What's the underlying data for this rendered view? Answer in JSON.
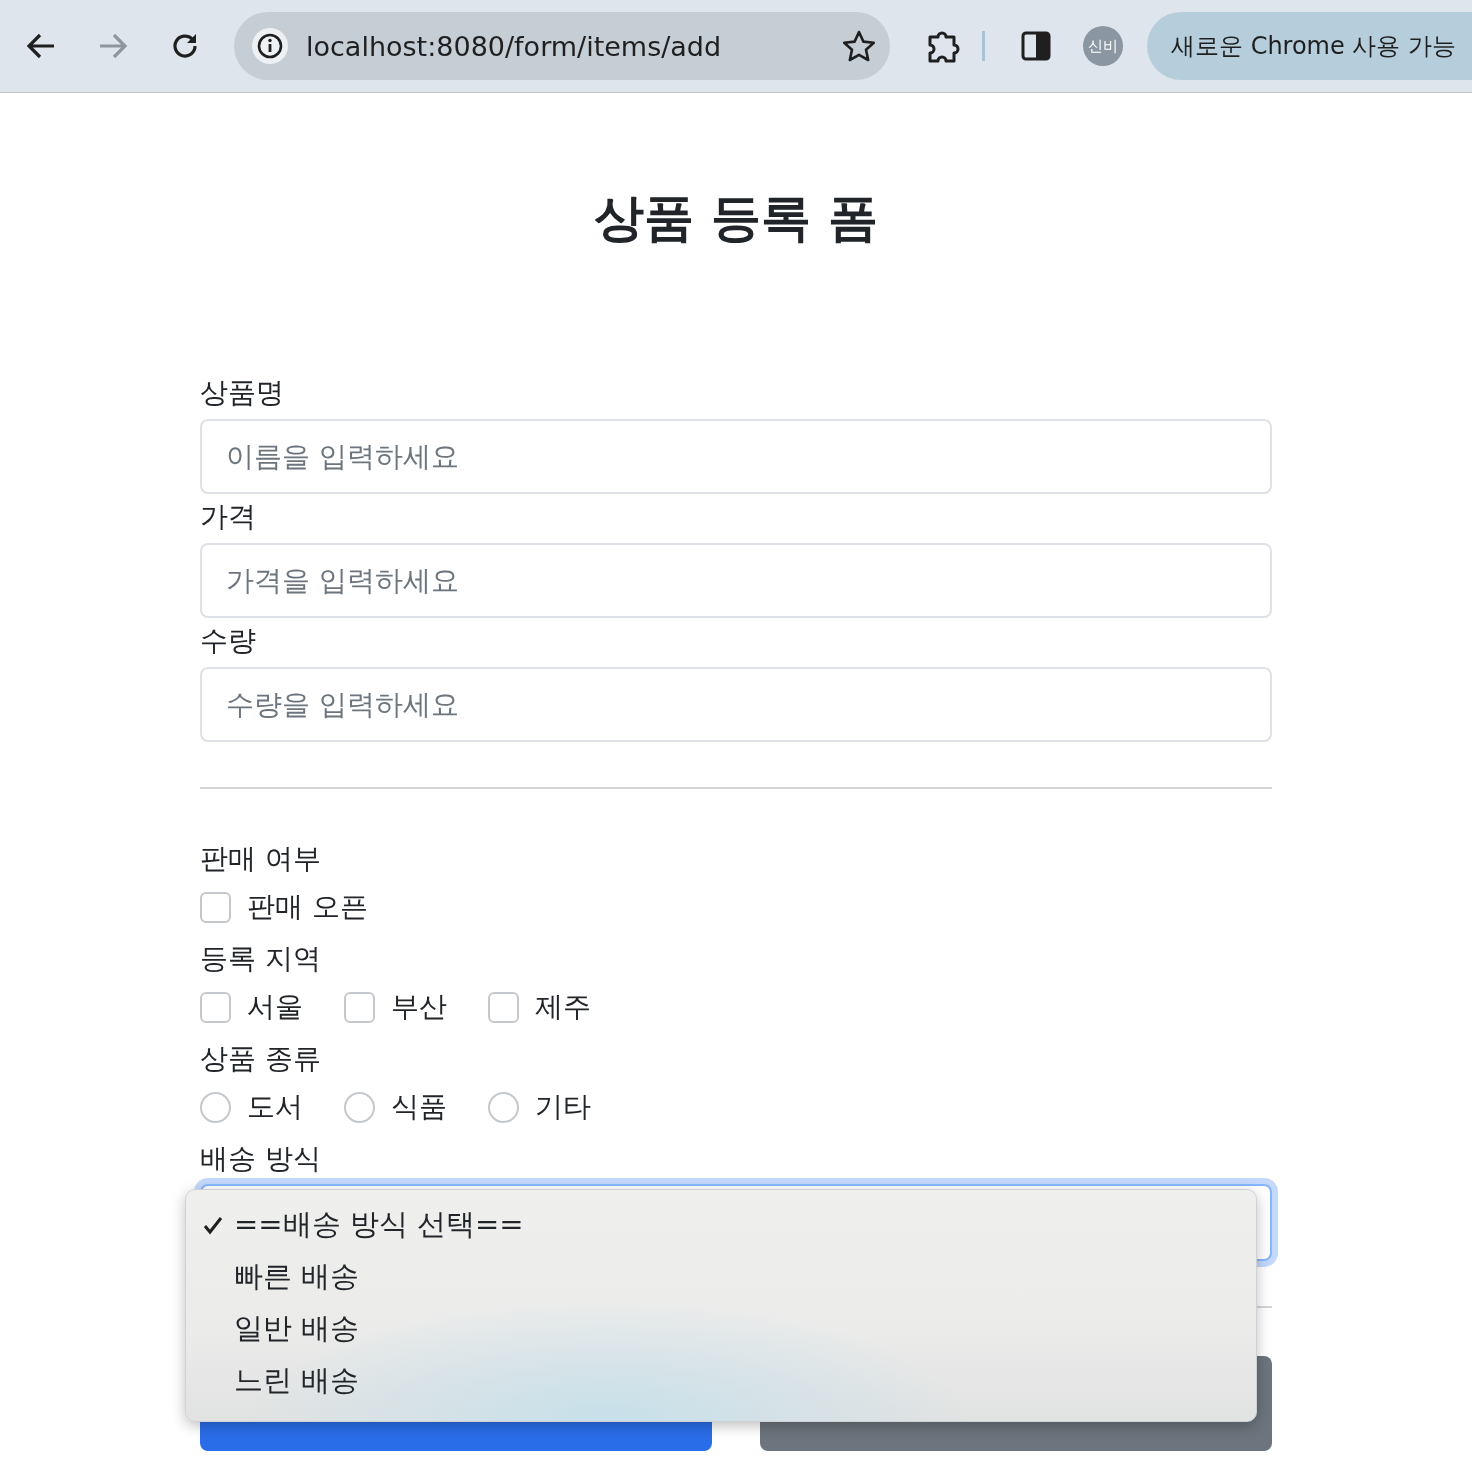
{
  "browser": {
    "url": "localhost:8080/form/items/add",
    "profile": "신비",
    "promo": "새로운 Chrome 사용 가능"
  },
  "page": {
    "title": "상품 등록 폼",
    "fields": [
      {
        "label": "상품명",
        "placeholder": "이름을 입력하세요"
      },
      {
        "label": "가격",
        "placeholder": "가격을 입력하세요"
      },
      {
        "label": "수량",
        "placeholder": "수량을 입력하세요"
      }
    ],
    "groups": [
      {
        "kind": "checkbox",
        "label": "판매 여부",
        "options": [
          {
            "label": "판매 오픈",
            "checked": false
          }
        ]
      },
      {
        "kind": "checkbox",
        "label": "등록 지역",
        "options": [
          {
            "label": "서울",
            "checked": false
          },
          {
            "label": "부산",
            "checked": false
          },
          {
            "label": "제주",
            "checked": false
          }
        ]
      },
      {
        "kind": "radio",
        "label": "상품 종류",
        "options": [
          {
            "label": "도서",
            "selected": false
          },
          {
            "label": "식품",
            "selected": false
          },
          {
            "label": "기타",
            "selected": false
          }
        ]
      }
    ],
    "delivery": {
      "label": "배송 방식",
      "focused": true,
      "expanded": true,
      "options": [
        {
          "label": "==배송 방식 선택==",
          "selected": true
        },
        {
          "label": "빠른 배송",
          "selected": false
        },
        {
          "label": "일반 배송",
          "selected": false
        },
        {
          "label": "느린 배송",
          "selected": false
        }
      ]
    },
    "buttons": [
      {
        "kind": "primary"
      },
      {
        "kind": "secondary"
      }
    ]
  }
}
